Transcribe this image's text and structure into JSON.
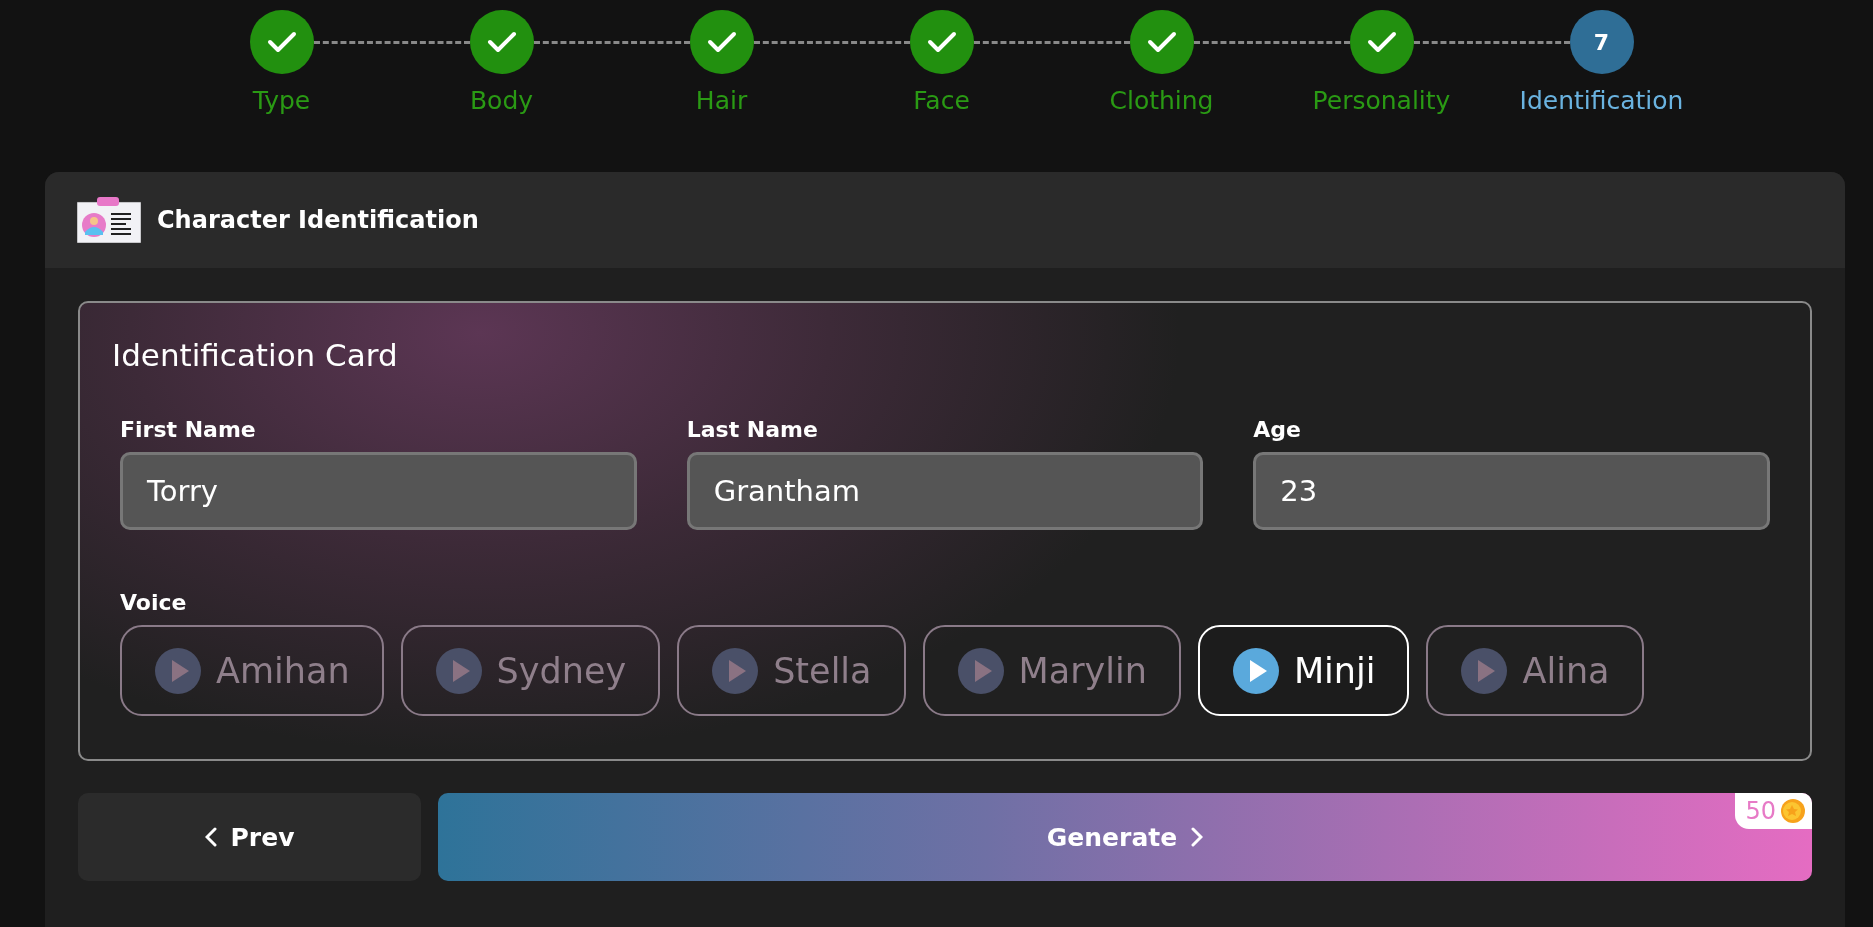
{
  "steps": [
    {
      "label": "Type",
      "completed": true
    },
    {
      "label": "Body",
      "completed": true
    },
    {
      "label": "Hair",
      "completed": true
    },
    {
      "label": "Face",
      "completed": true
    },
    {
      "label": "Clothing",
      "completed": true
    },
    {
      "label": "Personality",
      "completed": true
    },
    {
      "label": "Identification",
      "completed": false,
      "number": "7"
    }
  ],
  "panel": {
    "title": "Character Identification"
  },
  "card": {
    "title": "Identification Card",
    "fields": [
      {
        "label": "First Name",
        "value": "Torry"
      },
      {
        "label": "Last Name",
        "value": "Grantham"
      },
      {
        "label": "Age",
        "value": "23"
      }
    ],
    "voice_label": "Voice",
    "voices": [
      {
        "name": "Amihan",
        "selected": false
      },
      {
        "name": "Sydney",
        "selected": false
      },
      {
        "name": "Stella",
        "selected": false
      },
      {
        "name": "Marylin",
        "selected": false
      },
      {
        "name": "Minji",
        "selected": true
      },
      {
        "name": "Alina",
        "selected": false
      }
    ]
  },
  "prev_button": {
    "label": "Prev"
  },
  "generate_button": {
    "label": "Generate",
    "cost": "50"
  }
}
